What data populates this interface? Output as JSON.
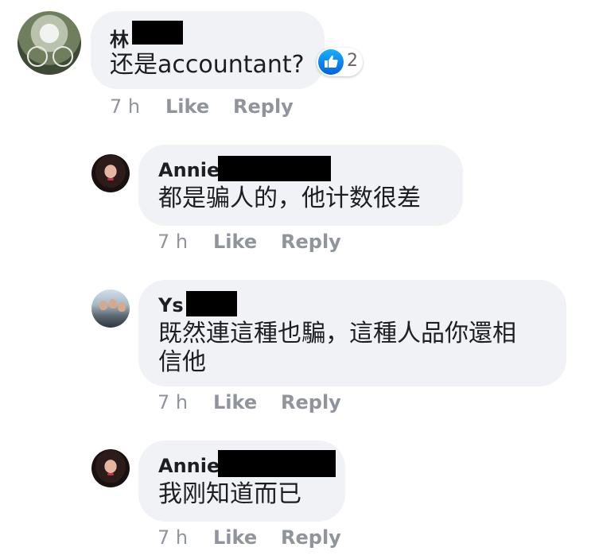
{
  "comments": [
    {
      "author": "林",
      "text": "还是accountant?",
      "reaction_count": "2",
      "meta": {
        "time": "7 h",
        "like": "Like",
        "reply": "Reply"
      }
    },
    {
      "author": "Annie",
      "text": "都是骗人的，他计数很差",
      "meta": {
        "time": "7 h",
        "like": "Like",
        "reply": "Reply"
      }
    },
    {
      "author": "Ys",
      "text_line1": "既然連這種也騙，這種人品你還相",
      "text_line2": "信他",
      "meta": {
        "time": "7 h",
        "like": "Like",
        "reply": "Reply"
      }
    },
    {
      "author": "Annie",
      "text": "我刚知道而已",
      "meta": {
        "time": "7 h",
        "like": "Like",
        "reply": "Reply"
      }
    }
  ],
  "colors": {
    "bubble": "#f0f2f5",
    "meta_text": "#90949c",
    "like_blue": "#1877f2"
  },
  "icons": {
    "reaction": "like-thumbs-up-icon"
  }
}
